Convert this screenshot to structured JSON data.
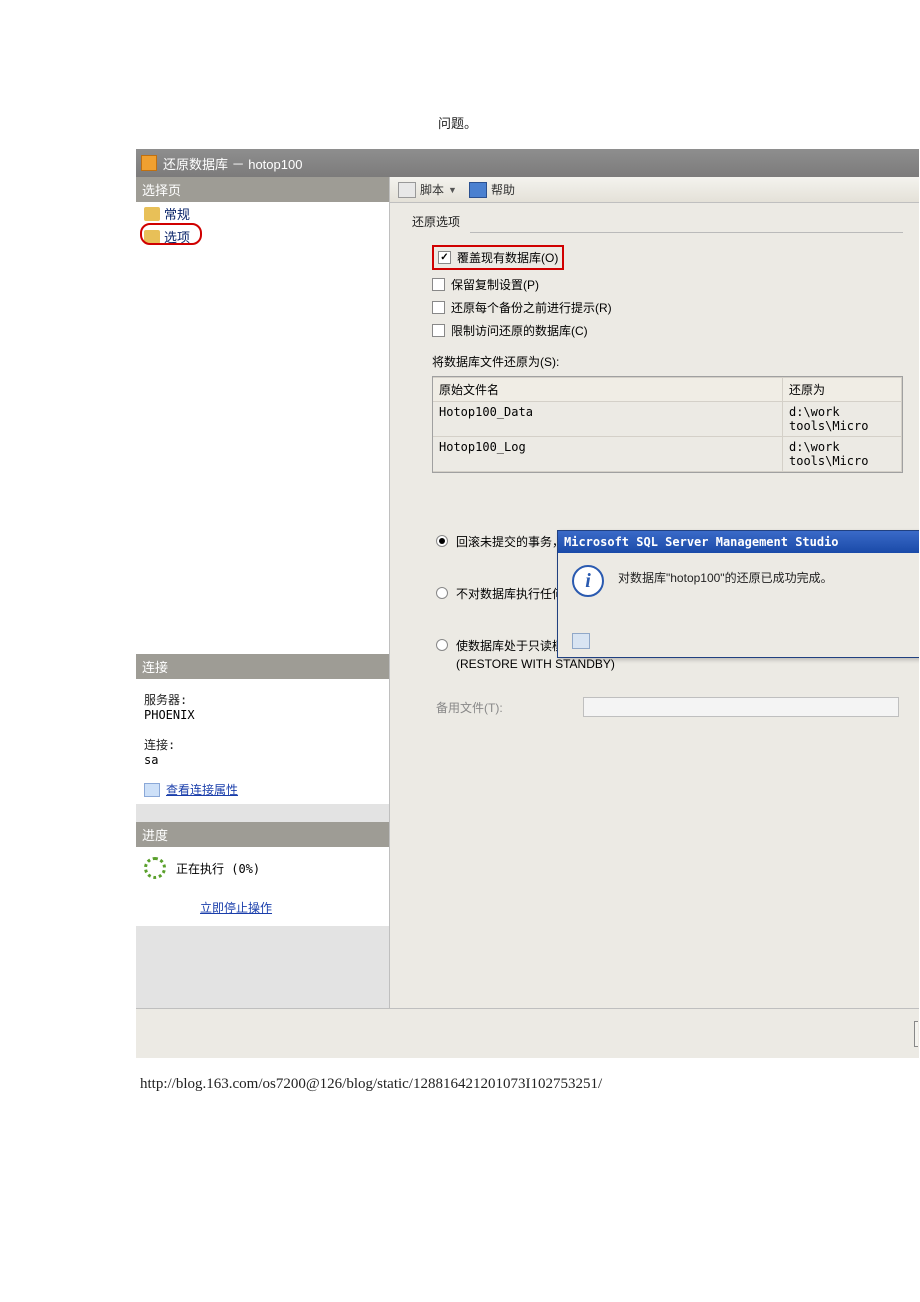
{
  "caption": "问题。",
  "window_title": "还原数据库 － hotop100",
  "left": {
    "section_select": "选择页",
    "tree_general": "常规",
    "tree_options": "选项",
    "section_conn": "连接",
    "server_lbl": "服务器:",
    "server_val": "PHOENIX",
    "conn_lbl": "连接:",
    "conn_val": "sa",
    "view_conn_props": "查看连接属性",
    "section_progress": "进度",
    "progress_text": "正在执行 (0%)",
    "stop_link": "立即停止操作"
  },
  "toolbar": {
    "script": "脚本",
    "help": "帮助"
  },
  "restore": {
    "group": "还原选项",
    "chk_overwrite": "覆盖现有数据库(O)",
    "chk_keep_repl": "保留复制设置(P)",
    "chk_prompt": "还原每个备份之前进行提示(R)",
    "chk_restrict": "限制访问还原的数据库(C)",
    "files_lbl": "将数据库文件还原为(S):",
    "grid_h1": "原始文件名",
    "grid_h2": "还原为",
    "r1c1": "Hotop100_Data",
    "r1c2": "d:\\work tools\\Micro",
    "r2c1": "Hotop100_Log",
    "r2c2": "d:\\work tools\\Micro",
    "opt1": "回滚未提交的事务，使数据库处于可以使用的状态。无法还原其他事务日志",
    "opt2": "不对数据库执行任何操作，不回滚未提交的事务。可以还原其他事务日志(A",
    "opt3a": "使数据库处于只读模式。撤消未提交的事务，但将撤消操作保存在备用文件",
    "opt3b": "(RESTORE WITH STANDBY)",
    "standby_lbl": "备用文件(T):"
  },
  "msgbox": {
    "title": "Microsoft SQL Server Management Studio",
    "text": "对数据库\"hotop100\"的还原已成功完成。"
  },
  "url": "http://blog.163.com/os7200@126/blog/static/128816421201073I102753251/"
}
